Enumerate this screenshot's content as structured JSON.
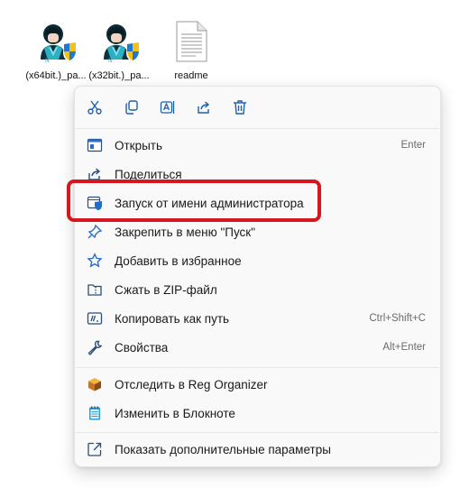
{
  "desktop": {
    "files": [
      {
        "name": "(x64bit.)_pa...",
        "icon": "user-shield-icon"
      },
      {
        "name": "(x32bit.)_pa...",
        "icon": "user-shield-icon"
      },
      {
        "name": "readme",
        "icon": "text-document-icon"
      }
    ]
  },
  "context_menu": {
    "toolbar": [
      {
        "name": "cut",
        "icon": "scissors-icon"
      },
      {
        "name": "copy",
        "icon": "copy-icon"
      },
      {
        "name": "rename",
        "icon": "rename-icon"
      },
      {
        "name": "share",
        "icon": "share-icon"
      },
      {
        "name": "delete",
        "icon": "trash-icon"
      }
    ],
    "items": [
      {
        "label": "Открыть",
        "shortcut": "Enter",
        "icon": "open-icon"
      },
      {
        "label": "Поделиться",
        "shortcut": "",
        "icon": "share-icon"
      },
      {
        "label": "Запуск от имени администратора",
        "shortcut": "",
        "icon": "admin-shield-icon"
      },
      {
        "label": "Закрепить в меню \"Пуск\"",
        "shortcut": "",
        "icon": "pin-icon"
      },
      {
        "label": "Добавить в избранное",
        "shortcut": "",
        "icon": "star-icon"
      },
      {
        "label": "Сжать в ZIP-файл",
        "shortcut": "",
        "icon": "zip-folder-icon"
      },
      {
        "label": "Копировать как путь",
        "shortcut": "Ctrl+Shift+C",
        "icon": "copy-path-icon"
      },
      {
        "label": "Свойства",
        "shortcut": "Alt+Enter",
        "icon": "wrench-icon"
      },
      {
        "label": "Отследить в Reg Organizer",
        "shortcut": "",
        "icon": "reg-organizer-icon"
      },
      {
        "label": "Изменить в Блокноте",
        "shortcut": "",
        "icon": "notepad-icon"
      },
      {
        "label": "Показать дополнительные параметры",
        "shortcut": "",
        "icon": "more-options-icon"
      }
    ]
  },
  "colors": {
    "accent": "#1f6fc4",
    "highlight_border": "#d8151c",
    "menu_bg": "#f9f9f9"
  }
}
